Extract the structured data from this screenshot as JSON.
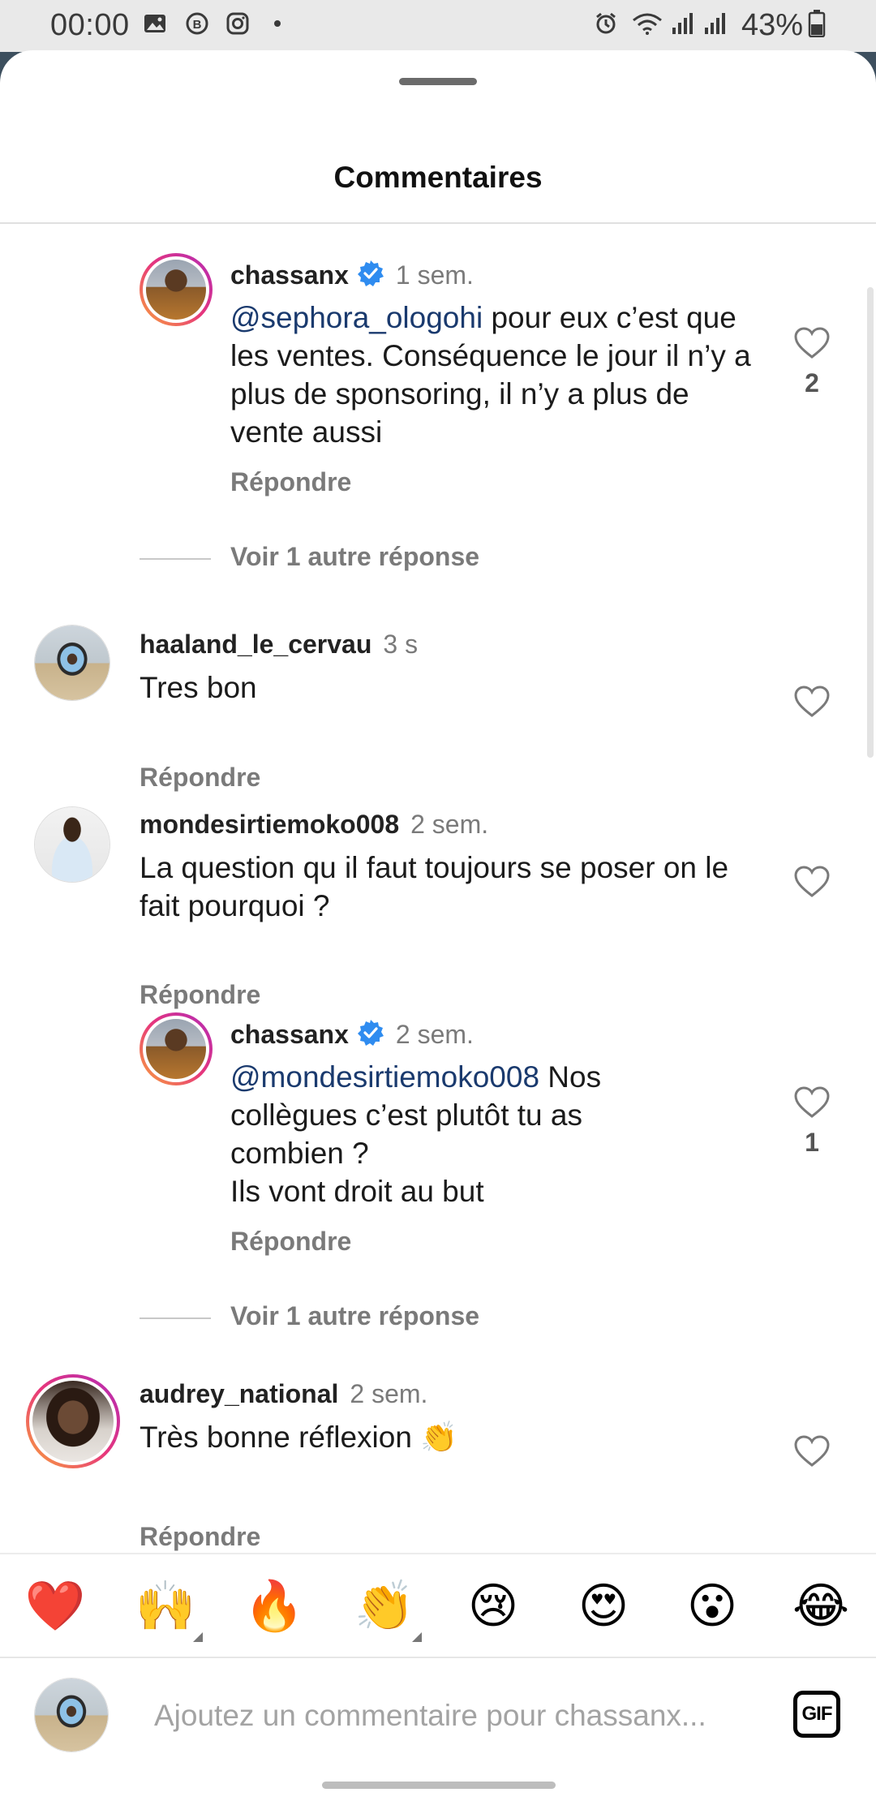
{
  "status_bar": {
    "time": "00:00",
    "battery": "43%",
    "left_icons": [
      "gallery-icon",
      "b-badge-icon",
      "instagram-icon",
      "dot-icon"
    ],
    "right_icons": [
      "alarm-icon",
      "wifi-icon",
      "signal-icon",
      "signal-icon",
      "battery-icon"
    ]
  },
  "sheet": {
    "title": "Commentaires"
  },
  "comments": [
    {
      "username": "chassanx",
      "verified": true,
      "time": "1 sem.",
      "mention": "@sephora_ologohi",
      "text": " pour eux c’est que les ventes. Conséquence le jour il n’y a plus de sponsoring, il n’y a plus de vente aussi",
      "reply_label": "Répondre",
      "likes": "2",
      "is_reply": true
    },
    {
      "username": "haaland_le_cervau",
      "time": "3 s",
      "text": "Tres bon",
      "reply_label": "Répondre",
      "is_reply": false
    },
    {
      "username": "mondesirtiemoko008",
      "time": "2 sem.",
      "text": "La question qu il faut toujours se poser on le fait pourquoi ?",
      "reply_label": "Répondre",
      "is_reply": false
    },
    {
      "username": "chassanx",
      "verified": true,
      "time": "2 sem.",
      "mention": "@mondesirtiemoko008",
      "text_line1": " Nos collègues c’est plutôt tu as combien ?",
      "text_line2": "Ils vont droit au but",
      "reply_label": "Répondre",
      "likes": "1",
      "is_reply": true
    },
    {
      "username": "audrey_national",
      "time": "2 sem.",
      "text": "Très bonne réflexion 👏",
      "reply_label": "Répondre",
      "is_reply": false
    }
  ],
  "view_more_replies": [
    "Voir 1 autre réponse",
    "Voir 1 autre réponse"
  ],
  "emoji_bar": [
    "❤️",
    "🙌",
    "🔥",
    "👏",
    "😢",
    "😍",
    "😮",
    "😂"
  ],
  "composer": {
    "placeholder": "Ajoutez un commentaire pour chassanx...",
    "gif_label": "GIF"
  },
  "colors": {
    "mention": "#1a3a6e",
    "verified": "#2f8cf0",
    "muted_text": "#7a7a7a"
  }
}
